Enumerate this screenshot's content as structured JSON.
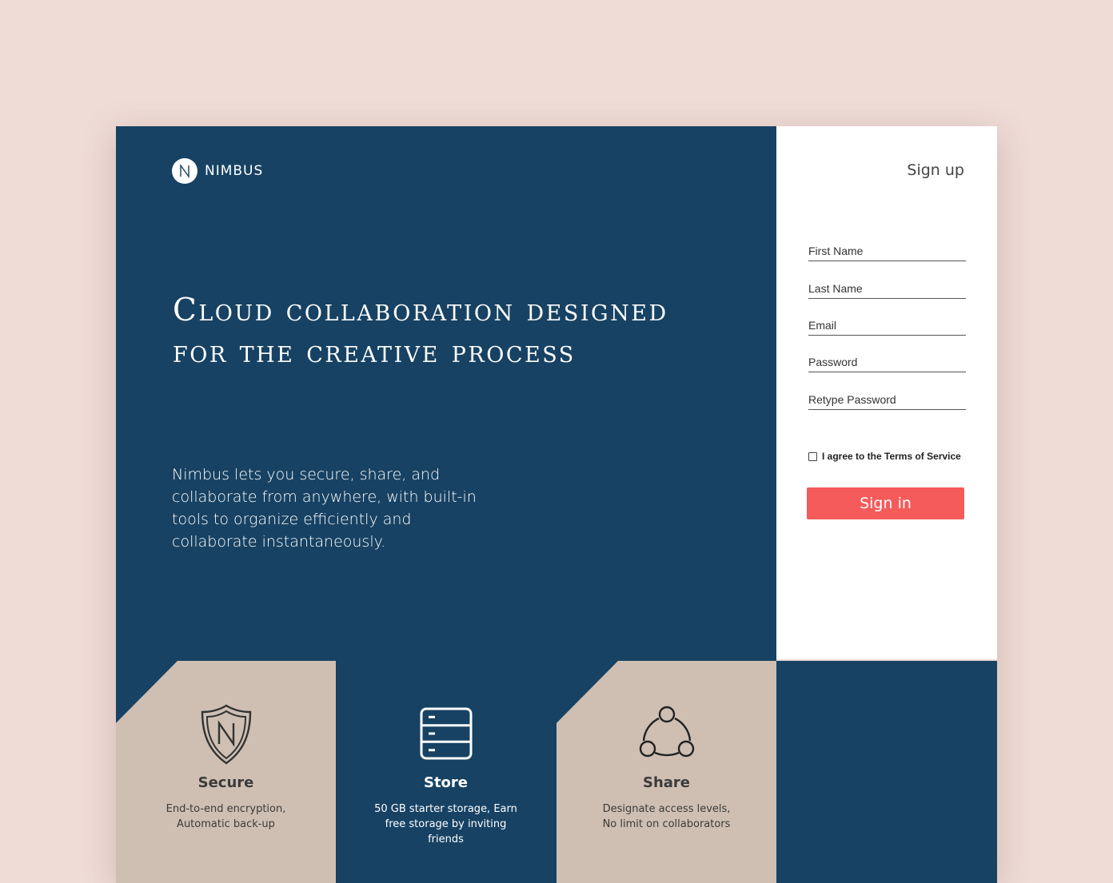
{
  "brand": {
    "name": "NIMBUS",
    "icon": "nimbus-logo-mark"
  },
  "hero": {
    "headline": "Cloud collaboration designed for the creative process",
    "tagline": "Nimbus lets you secure, share, and collaborate from anywhere, with built-in tools to organize efficiently and collaborate instantaneously."
  },
  "signup": {
    "title": "Sign up",
    "fields": {
      "first_name": {
        "placeholder": "First Name",
        "value": ""
      },
      "last_name": {
        "placeholder": "Last Name",
        "value": ""
      },
      "email": {
        "placeholder": "Email",
        "value": ""
      },
      "password": {
        "placeholder": "Password",
        "value": ""
      },
      "retype_password": {
        "placeholder": "Retype Password",
        "value": ""
      }
    },
    "terms_label": "I agree to the Terms of Service",
    "terms_checked": false,
    "submit_label": "Sign in"
  },
  "features": [
    {
      "title": "Secure",
      "desc": "End-to-end encryption, Automatic back-up",
      "icon": "shield-icon"
    },
    {
      "title": "Store",
      "desc": "50 GB starter storage, Earn free storage by inviting friends",
      "icon": "storage-icon"
    },
    {
      "title": "Share",
      "desc": "Designate access levels, No limit on collaborators",
      "icon": "share-icon"
    }
  ],
  "colors": {
    "background": "#efdcd6",
    "navy": "#174263",
    "tan": "#cfbfb2",
    "accent": "#f55b5b",
    "panel": "#ffffff"
  }
}
